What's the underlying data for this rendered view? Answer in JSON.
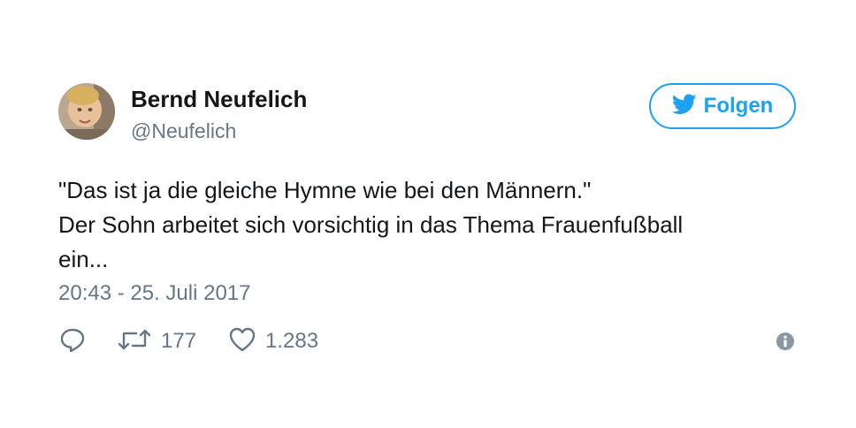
{
  "author": {
    "name": "Bernd Neufelich",
    "handle": "@Neufelich",
    "avatar_icon": "user-photo-avatar"
  },
  "follow_button": {
    "label": "Folgen",
    "icon": "twitter-bird-icon",
    "color": "#1da1f2"
  },
  "tweet": {
    "lines": [
      "\"Das ist ja die gleiche Hymne wie bei den Männern.\"",
      "Der Sohn arbeitet sich vorsichtig in das Thema Frauenfußball",
      "ein..."
    ],
    "timestamp": "20:43 - 25. Juli 2017"
  },
  "actions": {
    "reply": {
      "icon": "reply-icon"
    },
    "retweet": {
      "icon": "retweet-icon",
      "count": "177"
    },
    "like": {
      "icon": "heart-icon",
      "count": "1.283"
    },
    "info": {
      "icon": "info-icon"
    }
  },
  "colors": {
    "text_primary": "#14171a",
    "text_secondary": "#657786",
    "accent": "#1da1f2"
  }
}
